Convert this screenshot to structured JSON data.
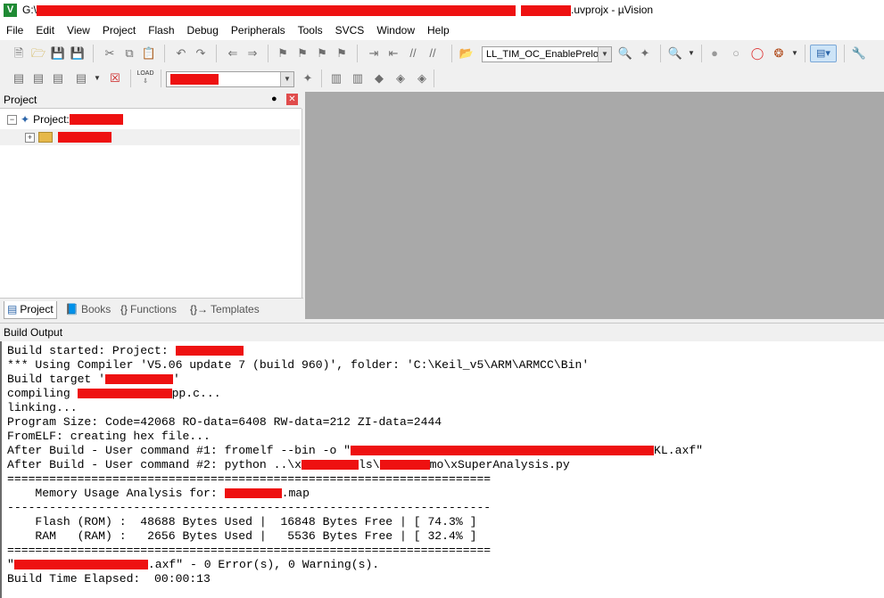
{
  "window": {
    "title_prefix": "G:\\",
    "title_suffix": ".uvprojx - µVision",
    "app_icon_glyph": "V"
  },
  "menu": [
    "File",
    "Edit",
    "View",
    "Project",
    "Flash",
    "Debug",
    "Peripherals",
    "Tools",
    "SVCS",
    "Window",
    "Help"
  ],
  "toolbar1": {
    "target_combo": "LL_TIM_OC_EnablePreloa"
  },
  "toolbar2": {
    "load_label": "LOAD"
  },
  "project_panel": {
    "title": "Project",
    "pin_glyph": "❀",
    "root_label": "Project: ",
    "tabs": [
      "Project",
      "Books",
      "Functions",
      "Templates"
    ]
  },
  "build_output": {
    "title": "Build Output",
    "lines": {
      "l1": "Build started: Project: ",
      "l2": "*** Using Compiler 'V5.06 update 7 (build 960)', folder: 'C:\\Keil_v5\\ARM\\ARMCC\\Bin'",
      "l3a": "Build target '",
      "l3b": "'",
      "l4a": "compiling ",
      "l4b": "pp.c...",
      "l5": "linking...",
      "l6": "Program Size: Code=42068 RO-data=6408 RW-data=212 ZI-data=2444",
      "l7": "FromELF: creating hex file...",
      "l8a": "After Build - User command #1: fromelf --bin -o \"",
      "l8b": "KL.axf\"",
      "l9a": "After Build - User command #2: python ..\\x",
      "l9b": "ls\\",
      "l9c": "mo\\xSuperAnalysis.py",
      "l10": "=====================================================================",
      "l11a": "    Memory Usage Analysis for: ",
      "l11b": ".map",
      "l12": "---------------------------------------------------------------------",
      "l13": "    Flash (ROM) :  48688 Bytes Used |  16848 Bytes Free | [ 74.3% ]",
      "l14": "    RAM   (RAM) :   2656 Bytes Used |   5536 Bytes Free | [ 32.4% ]",
      "l15": "=====================================================================",
      "l16a": "\"",
      "l16b": ".axf\" - 0 Error(s), 0 Warning(s).",
      "l17": "Build Time Elapsed:  00:00:13"
    }
  }
}
